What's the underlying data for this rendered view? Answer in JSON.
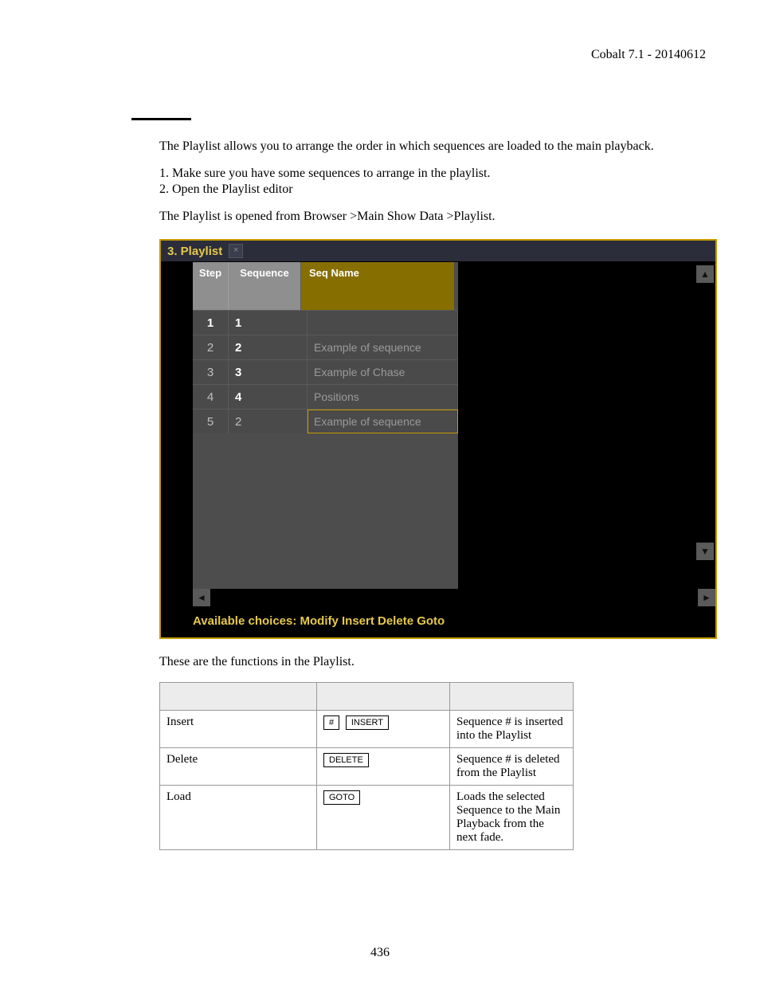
{
  "header": {
    "product_version": "Cobalt 7.1 - 20140612"
  },
  "intro": "The Playlist allows you to arrange the order in which sequences are loaded to the main playback.",
  "steps": [
    "1. Make sure you have some sequences to arrange in the playlist.",
    "2. Open the Playlist editor"
  ],
  "open_from": "The Playlist is opened from Browser >Main Show Data >Playlist.",
  "screenshot": {
    "tab_title": "3. Playlist",
    "columns": {
      "step": "Step",
      "sequence": "Sequence",
      "seq_name": "Seq Name"
    },
    "rows": [
      {
        "step": "1",
        "sequence": "1",
        "name": "",
        "selected": false,
        "bold": true
      },
      {
        "step": "2",
        "sequence": "2",
        "name": "Example of sequence",
        "selected": false,
        "bold": false
      },
      {
        "step": "3",
        "sequence": "3",
        "name": "Example of Chase",
        "selected": false,
        "bold": false
      },
      {
        "step": "4",
        "sequence": "4",
        "name": "Positions",
        "selected": false,
        "bold": false
      },
      {
        "step": "5",
        "sequence": "2",
        "name": "Example of sequence",
        "selected": true,
        "bold": false
      }
    ],
    "footer": "Available choices: Modify Insert Delete Goto"
  },
  "functions_intro": "These are the functions in the Playlist.",
  "functions_table": {
    "headers": [
      "",
      "",
      ""
    ],
    "rows": [
      {
        "name": "Insert",
        "keys": [
          "#",
          "INSERT"
        ],
        "desc": "Sequence # is inserted into the Playlist"
      },
      {
        "name": "Delete",
        "keys": [
          "DELETE"
        ],
        "desc": "Sequence # is deleted from the Playlist"
      },
      {
        "name": "Load",
        "keys": [
          "GOTO"
        ],
        "desc": "Loads the selected Sequence to the Main Playback from the next fade."
      }
    ]
  },
  "page_number": "436"
}
